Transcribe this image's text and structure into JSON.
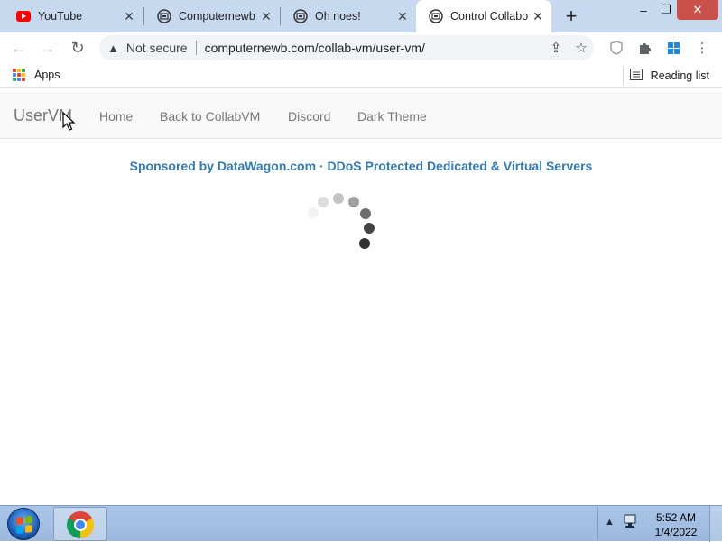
{
  "browser": {
    "tabs": [
      {
        "title": "YouTube",
        "icon": "youtube-icon",
        "active": false
      },
      {
        "title": "Computernewb",
        "icon": "collabvm-icon",
        "active": false
      },
      {
        "title": "Oh noes!",
        "icon": "collabvm-icon",
        "active": false
      },
      {
        "title": "Control Collabo",
        "icon": "collabvm-icon",
        "active": true
      }
    ],
    "new_tab_label": "+",
    "security_label": "Not secure",
    "url": "computernewb.com/collab-vm/user-vm/",
    "bookmarks": {
      "apps_label": "Apps",
      "reading_list_label": "Reading list"
    }
  },
  "site": {
    "brand": "UserVM",
    "nav": [
      {
        "label": "Home"
      },
      {
        "label": "Back to CollabVM"
      },
      {
        "label": "Discord"
      },
      {
        "label": "Dark Theme"
      }
    ],
    "sponsor_text": "Sponsored by DataWagon.com · DDoS Protected Dedicated & Virtual Servers",
    "loading": true
  },
  "taskbar": {
    "pinned": [
      {
        "name": "Google Chrome",
        "icon": "chrome-icon"
      }
    ],
    "clock_time": "5:52 AM",
    "clock_date": "1/4/2022"
  },
  "colors": {
    "tabstrip_bg": "#c7d9ef",
    "link_color": "#337ab7",
    "navbar_bg": "#f8f8f8",
    "nav_text": "#777777",
    "taskbar_bg": "#a9c4e6"
  }
}
